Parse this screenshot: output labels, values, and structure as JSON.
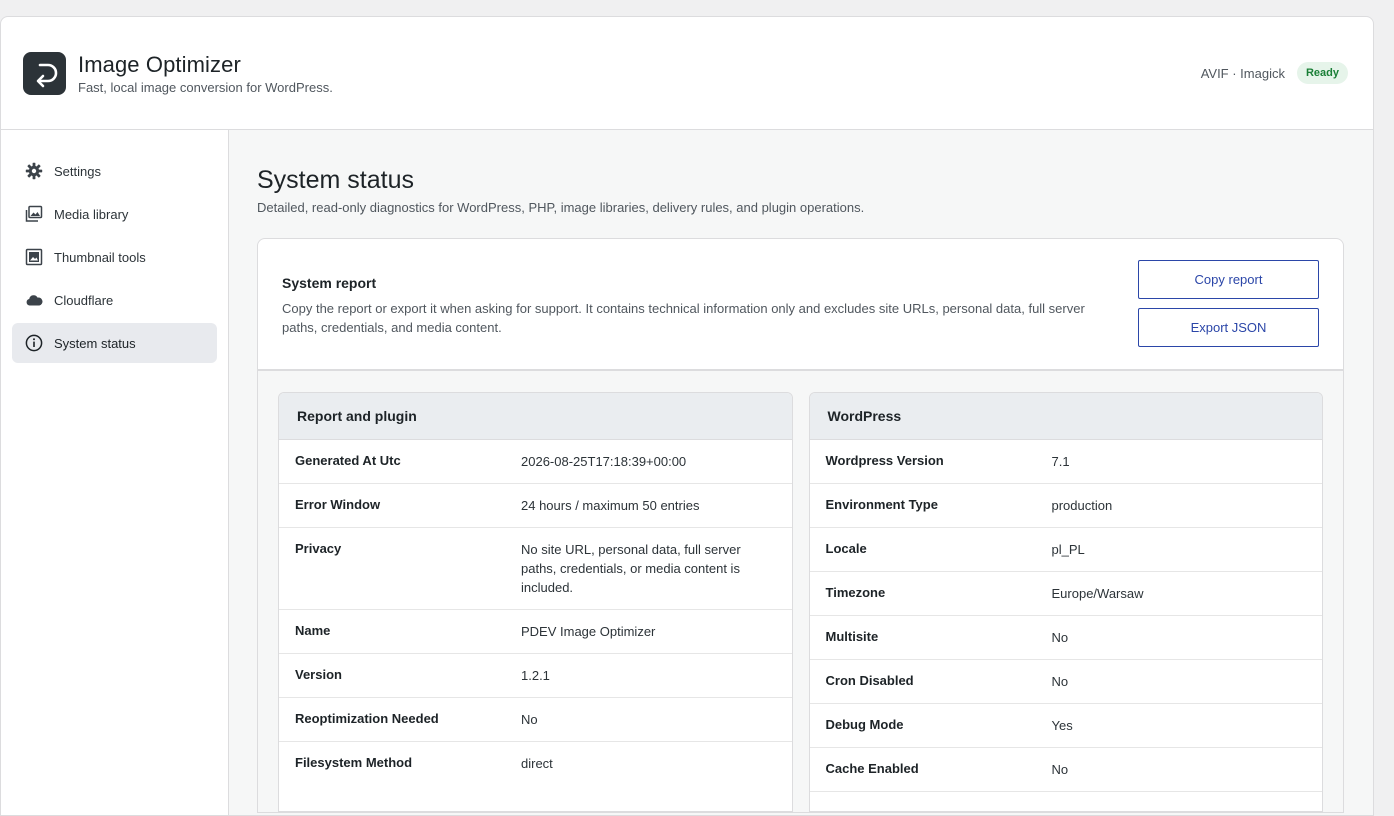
{
  "header": {
    "title": "Image Optimizer",
    "subtitle": "Fast, local image conversion for WordPress.",
    "engine": "AVIF · Imagick",
    "status_badge": "Ready"
  },
  "sidebar": {
    "items": [
      {
        "label": "Settings",
        "icon": "gear-icon",
        "active": false
      },
      {
        "label": "Media library",
        "icon": "images-icon",
        "active": false
      },
      {
        "label": "Thumbnail tools",
        "icon": "thumbnail-icon",
        "active": false
      },
      {
        "label": "Cloudflare",
        "icon": "cloud-icon",
        "active": false
      },
      {
        "label": "System status",
        "icon": "info-icon",
        "active": true
      }
    ]
  },
  "main": {
    "title": "System status",
    "description": "Detailed, read-only diagnostics for WordPress, PHP, image libraries, delivery rules, and plugin operations.",
    "report": {
      "title": "System report",
      "description": "Copy the report or export it when asking for support. It contains technical information only and excludes site URLs, personal data, full server paths, credentials, and media content.",
      "copy_label": "Copy report",
      "export_label": "Export JSON"
    },
    "panels": {
      "plugin": {
        "title": "Report and plugin",
        "rows": [
          {
            "key": "Generated At Utc",
            "value": "2026-08-25T17:18:39+00:00"
          },
          {
            "key": "Error Window",
            "value": "24 hours / maximum 50 entries"
          },
          {
            "key": "Privacy",
            "value": "No site URL, personal data, full server paths, credentials, or media content is included."
          },
          {
            "key": "Name",
            "value": "PDEV Image Optimizer"
          },
          {
            "key": "Version",
            "value": "1.2.1"
          },
          {
            "key": "Reoptimization Needed",
            "value": "No"
          },
          {
            "key": "Filesystem Method",
            "value": "direct"
          }
        ]
      },
      "wordpress": {
        "title": "WordPress",
        "rows": [
          {
            "key": "Wordpress Version",
            "value": "7.1"
          },
          {
            "key": "Environment Type",
            "value": "production"
          },
          {
            "key": "Locale",
            "value": "pl_PL"
          },
          {
            "key": "Timezone",
            "value": "Europe/Warsaw"
          },
          {
            "key": "Multisite",
            "value": "No"
          },
          {
            "key": "Cron Disabled",
            "value": "No"
          },
          {
            "key": "Debug Mode",
            "value": "Yes"
          },
          {
            "key": "Cache Enabled",
            "value": "No"
          }
        ]
      }
    }
  },
  "colors": {
    "accent": "#2b46a8",
    "ready_bg": "#e6f4ea",
    "ready_text": "#1a7f37",
    "logo_bg": "#2c3338"
  }
}
